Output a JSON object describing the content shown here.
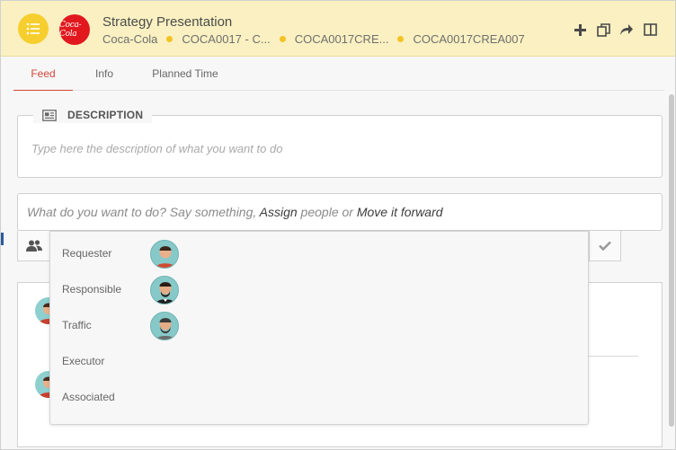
{
  "header": {
    "title": "Strategy Presentation",
    "brand_logo_text": "Coca-Cola",
    "crumbs": [
      "Coca-Cola",
      "COCA0017 - C...",
      "COCA0017CRE...",
      "COCA0017CREA007"
    ],
    "menu_icon": "list-icon",
    "actions": [
      "plus-icon",
      "copy-icon",
      "forward-icon",
      "split-view-icon"
    ],
    "accent": "#f6cf2f",
    "background": "#faf0c1"
  },
  "tabs": [
    {
      "label": "Feed",
      "active": true
    },
    {
      "label": "Info",
      "active": false
    },
    {
      "label": "Planned Time",
      "active": false
    }
  ],
  "description": {
    "label": "DESCRIPTION",
    "placeholder": "Type here the description of what you want to do",
    "icon": "newspaper-icon"
  },
  "say": {
    "prefix": "What do you want to do? Say something, ",
    "assign_link": "Assign",
    "middle": " people or ",
    "forward_link": "Move it forward"
  },
  "toolbar": {
    "people_icon": "people-icon",
    "confirm_icon": "check-icon"
  },
  "people_popup": {
    "roles": [
      {
        "label": "Requester",
        "has_avatar": true
      },
      {
        "label": "Responsible",
        "has_avatar": true
      },
      {
        "label": "Traffic",
        "has_avatar": true
      },
      {
        "label": "Executor",
        "has_avatar": false
      },
      {
        "label": "Associated",
        "has_avatar": false
      }
    ]
  },
  "colors": {
    "active_tab": "#d0473b",
    "avatar_bg": "#86c9c8"
  }
}
